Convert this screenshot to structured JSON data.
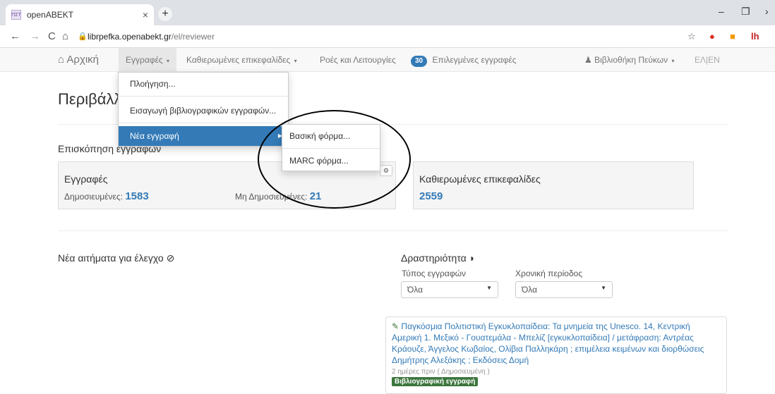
{
  "browser": {
    "tab_title": "openABEKT",
    "favicon_text": "ΠΣΤ",
    "close_glyph": "×",
    "newtab_glyph": "+",
    "window_controls": [
      "–",
      "❐",
      "›"
    ],
    "nav_icons": [
      "←",
      "→",
      "C",
      "⌂"
    ],
    "lock_glyph": "🔒",
    "url_host": "librpefka.openabekt.gr",
    "url_path": "/el/reviewer",
    "ext_icons": [
      {
        "name": "star-icon",
        "glyph": "☆",
        "color": "#555"
      },
      {
        "name": "adblock-icon",
        "glyph": "●",
        "color": "#d93025"
      },
      {
        "name": "extension-orange-icon",
        "glyph": "■",
        "color": "#f29900"
      },
      {
        "name": "extension-lh-icon",
        "glyph": "lh",
        "color": "#c5221f"
      }
    ]
  },
  "navbar": {
    "home": "Αρχική",
    "home_icon": "⌂",
    "records": "Εγγραφές",
    "authority": "Καθιερωμένες επικεφαλίδες",
    "flows": "Ροές και Λειτουργίες",
    "selected_count": "30",
    "selected": "Επιλεγμένες εγγραφές",
    "user_icon": "♟",
    "library": "Βιβλιοθήκη Πεύκων",
    "lang": "ΕΛ|EN",
    "caret": "▾"
  },
  "dropdown": {
    "items": [
      "Πλοήγηση...",
      "Εισαγωγή βιβλιογραφικών εγγραφών...",
      "Νέα εγγραφή"
    ],
    "arrow": "▶",
    "submenu": [
      "Βασική φόρμα...",
      "MARC φόρμα..."
    ]
  },
  "main": {
    "title": "Περιβάλλον ελέγχου",
    "overview": "Επισκόπηση εγγραφών",
    "records_panel": {
      "title": "Εγγραφές",
      "published_label": "Δημοσιευμένες:",
      "published": "1583",
      "unpublished_label": "Μη Δημοσιευμένες:",
      "unpublished": "21",
      "gear_glyph": "⚙"
    },
    "authority_panel": {
      "title": "Καθιερωμένες επικεφαλίδες",
      "count": "2559"
    },
    "requests_title": "Νέα αιτήματα για έλεγχο",
    "requests_icon": "⊘",
    "activity_title": "Δραστηριότητα",
    "activity_icon": "◗",
    "filter_type_label": "Τύπος εγγραφών",
    "filter_type_value": "Όλα",
    "filter_period_label": "Χρονική περίοδος",
    "filter_period_value": "Όλα",
    "select_arrow": "▼",
    "activity_item": {
      "pencil": "✎",
      "text": "Παγκόσμια Πολιτιστική Εγκυκλοπαίδεια: Τα μνημεία της Unesco. 14, Κεντρική Αμερική 1. Μεξικό - Γουατεμάλα - Μπελίζ [εγκυκλοπαίδεια] / μετάφραση: Αντρέας Κράουζε, Άγγελος Κωβαίος, Ολίβια Παλληκάρη ; επιμέλεια κειμένων και διορθώσεις Δημήτρης Αλεξάκης ; Εκδόσεις Δομή",
      "meta": "2 ημέρες πριν ( Δημοσιευμένη )",
      "tag": "Βιβλιογραφική εγγραφή"
    }
  }
}
